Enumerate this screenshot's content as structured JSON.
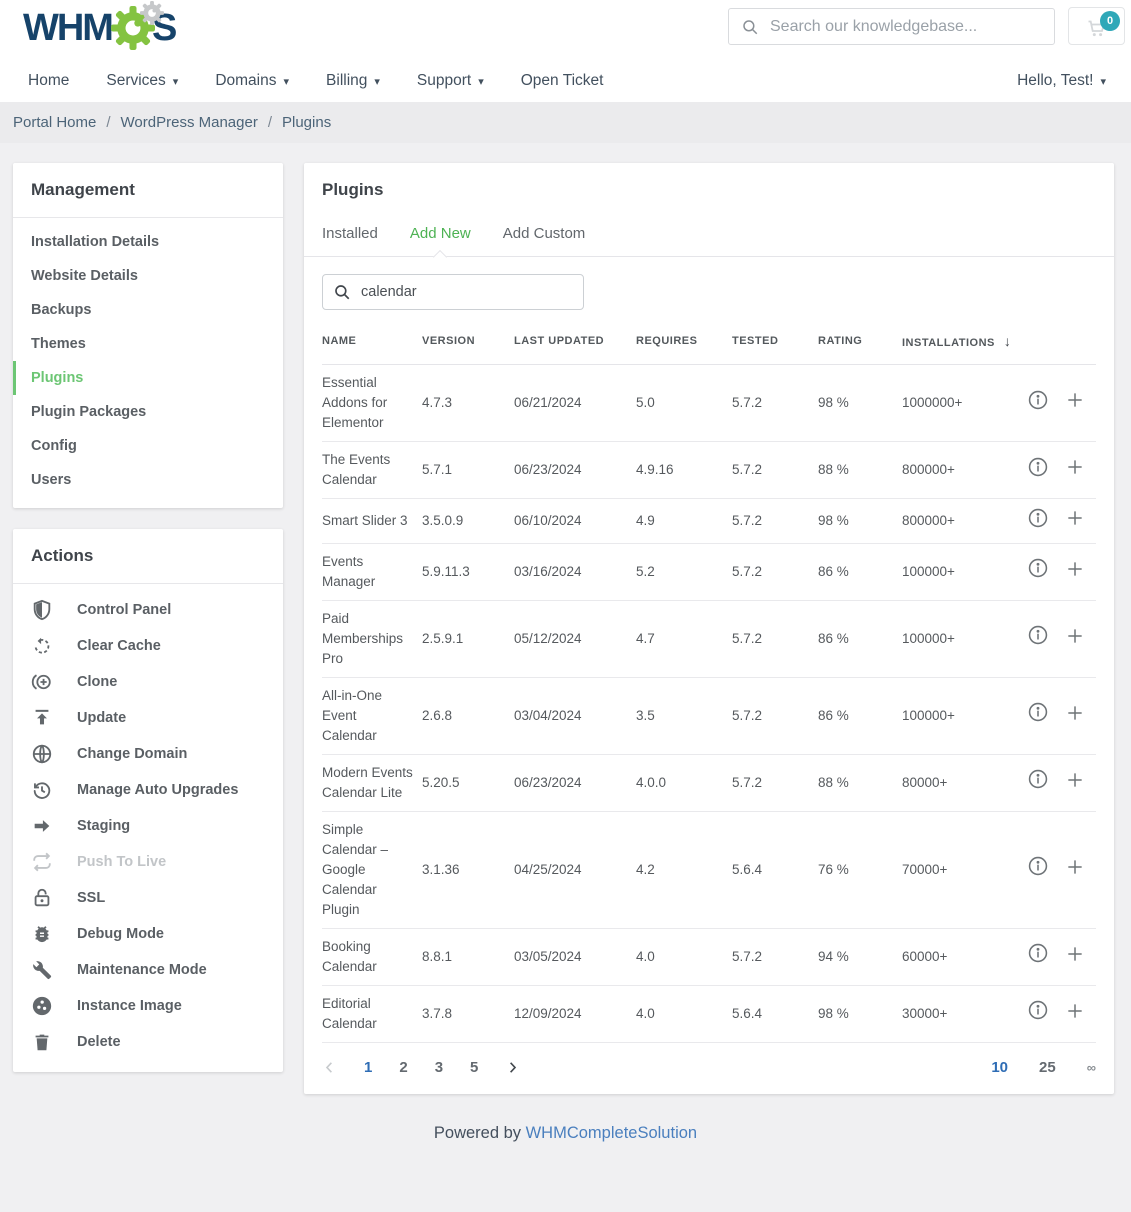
{
  "header": {
    "logo_text_left": "WHM",
    "logo_text_right": "S",
    "search": {
      "placeholder": "Search our knowledgebase..."
    },
    "cart": {
      "badge": "0"
    },
    "nav": {
      "items": [
        {
          "label": "Home",
          "caret": false
        },
        {
          "label": "Services",
          "caret": true
        },
        {
          "label": "Domains",
          "caret": true
        },
        {
          "label": "Billing",
          "caret": true
        },
        {
          "label": "Support",
          "caret": true
        },
        {
          "label": "Open Ticket",
          "caret": false
        }
      ],
      "user": {
        "label": "Hello, Test!",
        "caret": true
      }
    }
  },
  "breadcrumb": {
    "items": [
      "Portal Home",
      "WordPress Manager",
      "Plugins"
    ],
    "separator": "/"
  },
  "sidebar": {
    "management": {
      "title": "Management",
      "items": [
        {
          "label": "Installation Details",
          "active": false
        },
        {
          "label": "Website Details",
          "active": false
        },
        {
          "label": "Backups",
          "active": false
        },
        {
          "label": "Themes",
          "active": false
        },
        {
          "label": "Plugins",
          "active": true
        },
        {
          "label": "Plugin Packages",
          "active": false
        },
        {
          "label": "Config",
          "active": false
        },
        {
          "label": "Users",
          "active": false
        }
      ]
    },
    "actions": {
      "title": "Actions",
      "items": [
        {
          "label": "Control Panel",
          "icon": "shield-icon",
          "disabled": false
        },
        {
          "label": "Clear Cache",
          "icon": "clear-cache-icon",
          "disabled": false
        },
        {
          "label": "Clone",
          "icon": "clone-icon",
          "disabled": false
        },
        {
          "label": "Update",
          "icon": "update-icon",
          "disabled": false
        },
        {
          "label": "Change Domain",
          "icon": "globe-icon",
          "disabled": false
        },
        {
          "label": "Manage Auto Upgrades",
          "icon": "history-icon",
          "disabled": false
        },
        {
          "label": "Staging",
          "icon": "staging-arrow-icon",
          "disabled": false
        },
        {
          "label": "Push To Live",
          "icon": "push-live-icon",
          "disabled": true
        },
        {
          "label": "SSL",
          "icon": "lock-icon",
          "disabled": false
        },
        {
          "label": "Debug Mode",
          "icon": "bug-icon",
          "disabled": false
        },
        {
          "label": "Maintenance Mode",
          "icon": "wrench-icon",
          "disabled": false
        },
        {
          "label": "Instance Image",
          "icon": "instance-image-icon",
          "disabled": false
        },
        {
          "label": "Delete",
          "icon": "trash-icon",
          "disabled": false
        }
      ]
    }
  },
  "main": {
    "title": "Plugins",
    "tabs": [
      {
        "label": "Installed",
        "active": false
      },
      {
        "label": "Add New",
        "active": true
      },
      {
        "label": "Add Custom",
        "active": false
      }
    ],
    "search": {
      "value": "calendar"
    },
    "table": {
      "columns": [
        "NAME",
        "VERSION",
        "LAST UPDATED",
        "REQUIRES",
        "TESTED",
        "RATING",
        "INSTALLATIONS"
      ],
      "sorted_column": "INSTALLATIONS",
      "sort_direction": "desc",
      "rows": [
        {
          "name": "Essential Addons for Elementor",
          "version": "4.7.3",
          "last_updated": "06/21/2024",
          "requires": "5.0",
          "tested": "5.7.2",
          "rating": "98 %",
          "installations": "1000000+"
        },
        {
          "name": "The Events Calendar",
          "version": "5.7.1",
          "last_updated": "06/23/2024",
          "requires": "4.9.16",
          "tested": "5.7.2",
          "rating": "88 %",
          "installations": "800000+"
        },
        {
          "name": "Smart Slider 3",
          "version": "3.5.0.9",
          "last_updated": "06/10/2024",
          "requires": "4.9",
          "tested": "5.7.2",
          "rating": "98 %",
          "installations": "800000+"
        },
        {
          "name": "Events Manager",
          "version": "5.9.11.3",
          "last_updated": "03/16/2024",
          "requires": "5.2",
          "tested": "5.7.2",
          "rating": "86 %",
          "installations": "100000+"
        },
        {
          "name": "Paid Memberships Pro",
          "version": "2.5.9.1",
          "last_updated": "05/12/2024",
          "requires": "4.7",
          "tested": "5.7.2",
          "rating": "86 %",
          "installations": "100000+"
        },
        {
          "name": "All-in-One Event Calendar",
          "version": "2.6.8",
          "last_updated": "03/04/2024",
          "requires": "3.5",
          "tested": "5.7.2",
          "rating": "86 %",
          "installations": "100000+"
        },
        {
          "name": "Modern Events Calendar Lite",
          "version": "5.20.5",
          "last_updated": "06/23/2024",
          "requires": "4.0.0",
          "tested": "5.7.2",
          "rating": "88 %",
          "installations": "80000+"
        },
        {
          "name": "Simple Calendar – Google Calendar Plugin",
          "version": "3.1.36",
          "last_updated": "04/25/2024",
          "requires": "4.2",
          "tested": "5.6.4",
          "rating": "76 %",
          "installations": "70000+"
        },
        {
          "name": "Booking Calendar",
          "version": "8.8.1",
          "last_updated": "03/05/2024",
          "requires": "4.0",
          "tested": "5.7.2",
          "rating": "94 %",
          "installations": "60000+"
        },
        {
          "name": "Editorial Calendar",
          "version": "3.7.8",
          "last_updated": "12/09/2024",
          "requires": "4.0",
          "tested": "5.6.4",
          "rating": "98 %",
          "installations": "30000+"
        }
      ]
    },
    "pagination": {
      "pages": [
        "1",
        "2",
        "3",
        "5"
      ],
      "active_page": "1",
      "page_sizes": [
        "10",
        "25",
        "∞"
      ],
      "active_size": "10"
    }
  },
  "footer": {
    "text": "Powered by ",
    "link": "WHMCompleteSolution"
  },
  "icons": {
    "caret_down": "▾",
    "sort_desc": "↓"
  },
  "colors": {
    "brand_navy": "#16436a",
    "brand_green": "#84c341",
    "accent_green": "#4db253",
    "sidebar_active_green": "#6cc674",
    "link_blue": "#2f6db5",
    "badge_teal": "#2fa8b8"
  }
}
